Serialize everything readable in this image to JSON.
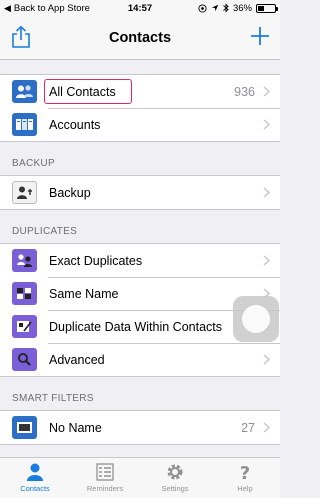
{
  "status_bar": {
    "back_label": "Back to App Store",
    "time": "14:57",
    "battery": "36%",
    "battery_level": 0.36
  },
  "nav": {
    "title": "Contacts",
    "share_icon": "share-icon",
    "add_icon": "plus-icon"
  },
  "groups": {
    "main": {
      "items": [
        {
          "label": "All Contacts",
          "count": "936",
          "icon": "contacts-icon"
        },
        {
          "label": "Accounts",
          "count": "",
          "icon": "accounts-icon"
        }
      ]
    },
    "backup": {
      "header": "BACKUP",
      "items": [
        {
          "label": "Backup",
          "icon": "backup-icon"
        }
      ]
    },
    "duplicates": {
      "header": "DUPLICATES",
      "items": [
        {
          "label": "Exact Duplicates",
          "icon": "exact-duplicates-icon"
        },
        {
          "label": "Same Name",
          "icon": "same-name-icon"
        },
        {
          "label": "Duplicate Data Within Contacts",
          "icon": "duplicate-data-icon"
        },
        {
          "label": "Advanced",
          "icon": "magnifier-icon"
        }
      ]
    },
    "smart_filters": {
      "header": "SMART FILTERS",
      "items": [
        {
          "label": "No Name",
          "count": "27",
          "icon": "no-name-icon"
        }
      ]
    }
  },
  "tabs": [
    {
      "label": "Contacts",
      "icon": "person-icon",
      "active": true
    },
    {
      "label": "Reminders",
      "icon": "list-icon",
      "active": false
    },
    {
      "label": "Settings",
      "icon": "gear-icon",
      "active": false
    },
    {
      "label": "Help",
      "icon": "question-icon",
      "active": false
    }
  ],
  "colors": {
    "accent": "#1a7de0",
    "highlight": "#e0245e",
    "icon_blue": "#2d6fc4",
    "icon_purple": "#7b5fd6"
  }
}
